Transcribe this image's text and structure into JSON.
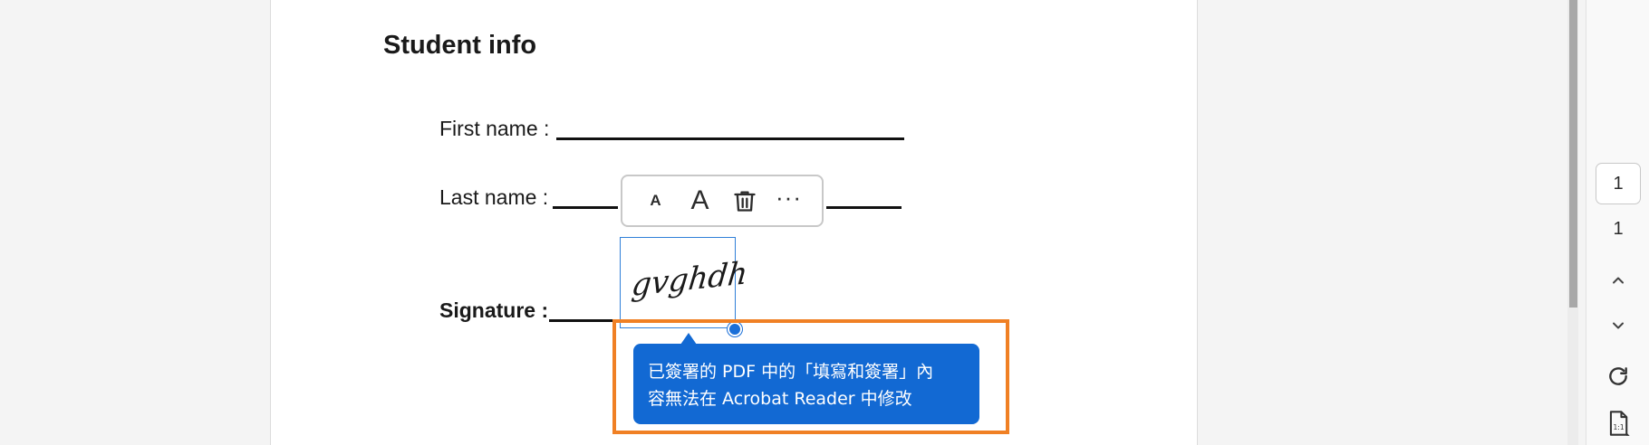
{
  "document": {
    "heading": "Student info",
    "fields": {
      "first_name": "First name :",
      "last_name": "Last name :",
      "signature": "Signature :"
    },
    "signature_text": "gvghdh"
  },
  "text_toolbar": {
    "small_label": "A",
    "large_label": "A",
    "more_label": "···",
    "icons": [
      "decrease-text-size-icon",
      "increase-text-size-icon",
      "trash-icon",
      "more-options-icon"
    ]
  },
  "tooltip": {
    "line1": "已簽署的 PDF 中的「填寫和簽署」內",
    "line2": "容無法在 Acrobat Reader 中修改"
  },
  "page_nav": {
    "current_page": "1",
    "total_pages": "1",
    "icons": [
      "chevron-up-icon",
      "chevron-down-icon",
      "rotate-icon",
      "actual-size-icon"
    ]
  },
  "colors": {
    "tooltip_bg": "#1269d3",
    "highlight_border": "#f08024",
    "selection_border": "#2f7fd8"
  }
}
